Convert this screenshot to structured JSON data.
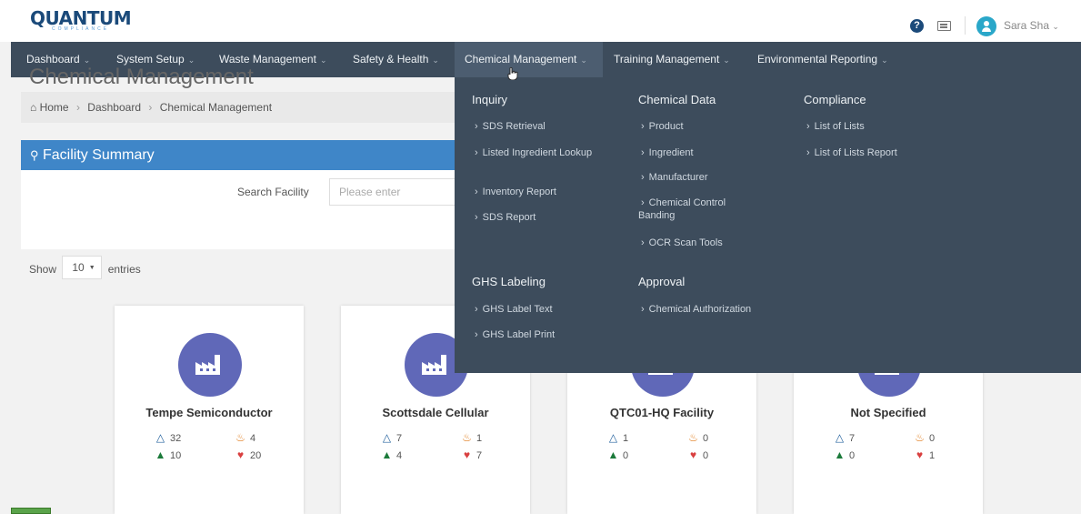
{
  "header": {
    "logo_text": "QUANTUM",
    "logo_sub": "COMPLIANCE",
    "user_name": "Sara Sha",
    "help_label": "?"
  },
  "nav": {
    "items": [
      {
        "label": "Dashboard"
      },
      {
        "label": "System Setup"
      },
      {
        "label": "Waste Management"
      },
      {
        "label": "Safety & Health"
      },
      {
        "label": "Chemical Management"
      },
      {
        "label": "Training Management"
      },
      {
        "label": "Environmental Reporting"
      }
    ],
    "active_index": 4
  },
  "page": {
    "title": "Chemical Management",
    "breadcrumb": [
      "Home",
      "Dashboard",
      "Chemical Management"
    ]
  },
  "facility_summary": {
    "title": "Facility Summary",
    "search_label": "Search Facility",
    "search_placeholder": "Please enter",
    "search_value": ""
  },
  "entries": {
    "show_label": "Show",
    "value": "10",
    "entries_label": "entries"
  },
  "cards": [
    {
      "name": "Tempe Semiconductor",
      "flask": "32",
      "fire": "4",
      "tree": "10",
      "heart": "20"
    },
    {
      "name": "Scottsdale Cellular",
      "flask": "7",
      "fire": "1",
      "tree": "4",
      "heart": "7"
    },
    {
      "name": "QTC01-HQ Facility",
      "flask": "1",
      "fire": "0",
      "tree": "0",
      "heart": "0"
    },
    {
      "name": "Not Specified",
      "flask": "7",
      "fire": "0",
      "tree": "0",
      "heart": "1"
    }
  ],
  "mega_menu": {
    "inquiry": {
      "heading": "Inquiry",
      "links": [
        "SDS Retrieval",
        "Listed Ingredient Lookup",
        "Inventory Report",
        "SDS Report"
      ]
    },
    "ghs": {
      "heading": "GHS Labeling",
      "links": [
        "GHS Label Text",
        "GHS Label Print"
      ]
    },
    "chemical_data": {
      "heading": "Chemical Data",
      "links": [
        "Product",
        "Ingredient",
        "Manufacturer",
        "Chemical Control Banding",
        "OCR Scan Tools"
      ]
    },
    "approval": {
      "heading": "Approval",
      "links": [
        "Chemical Authorization"
      ]
    },
    "compliance": {
      "heading": "Compliance",
      "links": [
        "List of Lists",
        "List of Lists Report"
      ]
    }
  },
  "colors": {
    "nav_bg": "#3d4c5c",
    "panel_header": "#3f86c8",
    "card_icon": "#6068b8",
    "brand": "#1b4a7a"
  }
}
